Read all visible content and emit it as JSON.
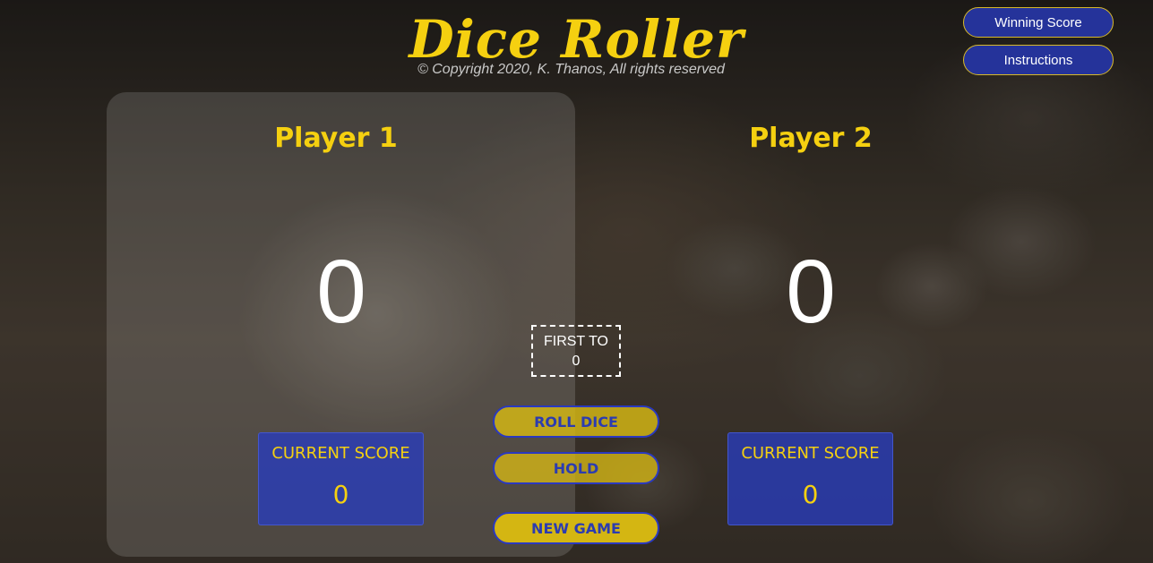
{
  "app": {
    "title": "Dice Roller",
    "copyright": "© Copyright 2020, K. Thanos, All rights reserved"
  },
  "top_buttons": {
    "winning_score": "Winning Score",
    "instructions": "Instructions"
  },
  "players": [
    {
      "name": "Player 1",
      "total_score": "0",
      "current_label": "CURRENT SCORE",
      "current_score": "0",
      "active": true
    },
    {
      "name": "Player 2",
      "total_score": "0",
      "current_label": "CURRENT SCORE",
      "current_score": "0",
      "active": false
    }
  ],
  "target": {
    "label": "FIRST TO",
    "value": "0"
  },
  "controls": {
    "roll": "ROLL DICE",
    "hold": "HOLD",
    "new_game": "NEW GAME"
  },
  "colors": {
    "accent_yellow": "#f5d010",
    "accent_blue": "#25339a"
  }
}
